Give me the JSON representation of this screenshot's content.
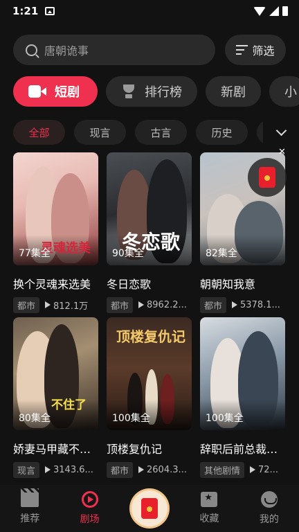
{
  "status_bar": {
    "time": "1:21"
  },
  "search": {
    "placeholder": "唐朝诡事",
    "filter_label": "筛选"
  },
  "category_tabs": [
    {
      "label": "短剧",
      "icon": "video-icon",
      "active": true
    },
    {
      "label": "排行榜",
      "icon": "trophy-icon",
      "active": false
    },
    {
      "label": "新剧",
      "active": false
    },
    {
      "label": "小",
      "active": false
    }
  ],
  "genre_filters": [
    {
      "label": "全部",
      "active": true
    },
    {
      "label": "现言"
    },
    {
      "label": "古言"
    },
    {
      "label": "历史"
    },
    {
      "label": ""
    }
  ],
  "dramas": [
    {
      "title": "换个灵魂来选美",
      "episodes": "77集全",
      "tag": "都市",
      "views": "812.1万",
      "cover_text": "灵魂选美"
    },
    {
      "title": "冬日恋歌",
      "episodes": "90集全",
      "tag": "都市",
      "views": "8962.2...",
      "cover_text": "冬恋歌"
    },
    {
      "title": "朝朝知我意",
      "episodes": "82集全",
      "tag": "都市",
      "views": "5378.1...",
      "cover_text": ""
    },
    {
      "title": "娇妻马甲藏不住...",
      "episodes": "80集全",
      "tag": "现言",
      "views": "3143.6...",
      "cover_text": "不住了"
    },
    {
      "title": "顶楼复仇记",
      "episodes": "100集全",
      "tag": "都市",
      "views": "2604.3...",
      "cover_text": "顶楼复仇记"
    },
    {
      "title": "辞职后前总裁对...",
      "episodes": "100集全",
      "tag": "其他剧情",
      "views": "72...",
      "cover_text": ""
    }
  ],
  "bottom_nav": [
    {
      "label": "推荐",
      "icon": "clapperboard-icon"
    },
    {
      "label": "剧场",
      "icon": "theater-play-icon",
      "active": true
    },
    {
      "label": "",
      "icon": "red-packet-icon"
    },
    {
      "label": "收藏",
      "icon": "favorite-star-icon"
    },
    {
      "label": "我的",
      "icon": "profile-face-icon"
    }
  ],
  "colors": {
    "accent": "#f0304f",
    "background": "#121212",
    "surface": "#2a2a2a"
  }
}
